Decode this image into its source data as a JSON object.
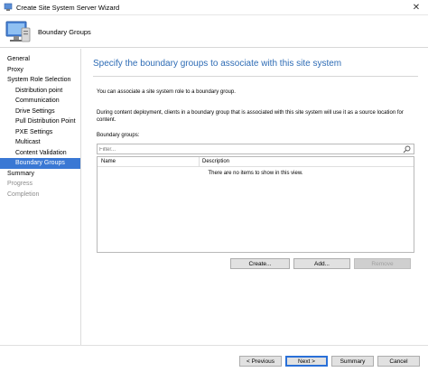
{
  "window": {
    "title": "Create Site System Server Wizard",
    "close_glyph": "✕"
  },
  "header": {
    "title": "Boundary Groups"
  },
  "sidebar": {
    "items": [
      {
        "label": "General"
      },
      {
        "label": "Proxy"
      },
      {
        "label": "System Role Selection"
      },
      {
        "label": "Distribution point"
      },
      {
        "label": "Communication"
      },
      {
        "label": "Drive Settings"
      },
      {
        "label": "Pull Distribution Point"
      },
      {
        "label": "PXE Settings"
      },
      {
        "label": "Multicast"
      },
      {
        "label": "Content Validation"
      },
      {
        "label": "Boundary Groups"
      },
      {
        "label": "Summary"
      },
      {
        "label": "Progress"
      },
      {
        "label": "Completion"
      }
    ]
  },
  "main": {
    "title": "Specify the boundary groups to associate with this site system",
    "text_1": "You can associate a site system role to a boundary group.",
    "text_2": "During content deployment, clients in a boundary group that is associated with this site system will use it as a source location for content.",
    "boundary_groups_label": "Boundary groups:",
    "filter_placeholder": "Filter...",
    "columns": {
      "name": "Name",
      "description": "Description"
    },
    "empty_message": "There are no items to show in this view.",
    "buttons": {
      "create": "Create...",
      "add": "Add...",
      "remove": "Remove"
    }
  },
  "footer": {
    "previous": "< Previous",
    "next": "Next >",
    "summary": "Summary",
    "cancel": "Cancel"
  },
  "colors": {
    "accent": "#3a78d4",
    "title_blue": "#2e6cb5"
  }
}
